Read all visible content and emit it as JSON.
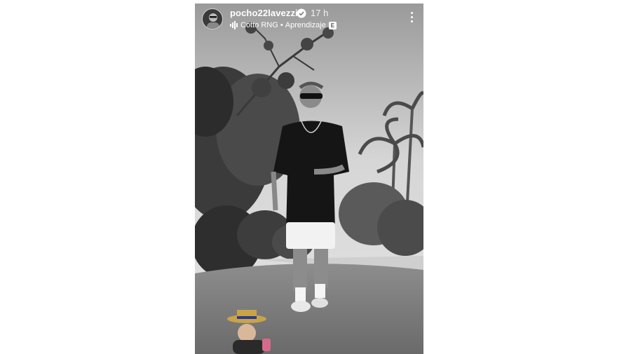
{
  "story": {
    "username": "pocho22lavezzi",
    "time": "17 h",
    "music_artist": "Cotto RNG",
    "music_song": "Aprendizaje",
    "music_separator": " • ",
    "explicit_badge": "E",
    "is_verified": true
  },
  "icons": {
    "verified": "verified-badge-icon",
    "music": "music-bars-icon",
    "more": "more-vertical-icon"
  },
  "colors": {
    "page_background": "#ffffff",
    "header_text": "#ffffff"
  }
}
